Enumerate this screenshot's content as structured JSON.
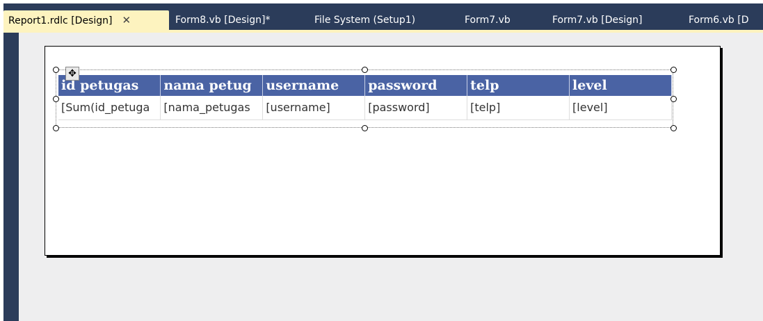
{
  "tabs": [
    {
      "label": "Report1.rdlc [Design]",
      "active": true
    },
    {
      "label": "Form8.vb [Design]*",
      "active": false
    },
    {
      "label": "File System (Setup1)",
      "active": false
    },
    {
      "label": "Form7.vb",
      "active": false
    },
    {
      "label": "Form7.vb [Design]",
      "active": false
    },
    {
      "label": "Form6.vb [D",
      "active": false
    }
  ],
  "close_glyph": "✕",
  "move_glyph": "✥",
  "icons": {
    "close": "close-icon",
    "move": "move-handle-icon"
  },
  "colors": {
    "tab_strip": "#2b3c5a",
    "active_tab": "#fdf3bf",
    "header_fill": "#4a63a4",
    "surface": "#eeeeef"
  },
  "table": {
    "headers": [
      "id petugas",
      "nama petug",
      "username",
      "password",
      "telp",
      "level"
    ],
    "row": [
      "[Sum(id_petuga",
      "[nama_petugas",
      "[username]",
      "[password]",
      "[telp]",
      "[level]"
    ]
  }
}
